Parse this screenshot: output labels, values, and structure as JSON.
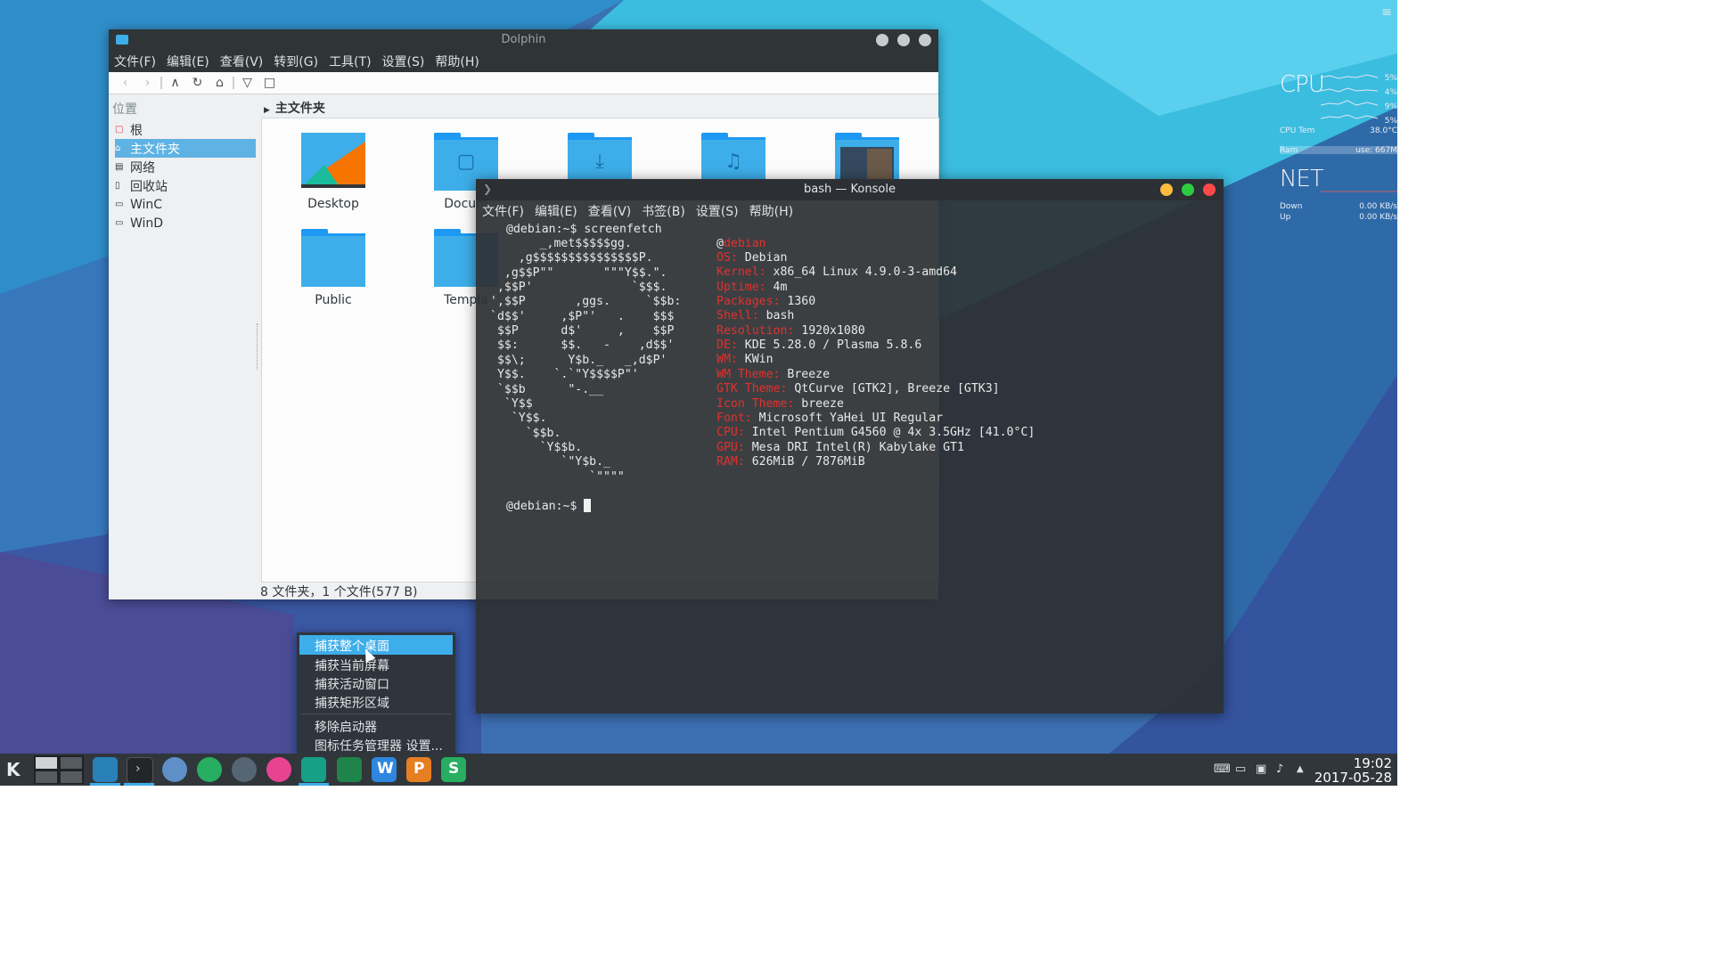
{
  "dolphin": {
    "title": "Dolphin",
    "menu": [
      "文件(F)",
      "编辑(E)",
      "查看(V)",
      "转到(G)",
      "工具(T)",
      "设置(S)",
      "帮助(H)"
    ],
    "places_header": "位置",
    "places": [
      {
        "label": "根",
        "icon": "root-folder-icon"
      },
      {
        "label": "主文件夹",
        "icon": "home-icon",
        "selected": true
      },
      {
        "label": "网络",
        "icon": "network-icon"
      },
      {
        "label": "回收站",
        "icon": "trash-icon"
      },
      {
        "label": "WinC",
        "icon": "drive-icon"
      },
      {
        "label": "WinD",
        "icon": "drive-icon"
      }
    ],
    "breadcrumb": "主文件夹",
    "files": [
      {
        "label": "Desktop"
      },
      {
        "label": "Docum"
      },
      {
        "label": "Public"
      },
      {
        "label": "Templa"
      }
    ],
    "status": "8 文件夹，1 个文件(577 B)"
  },
  "konsole": {
    "title": "bash — Konsole",
    "menu": [
      "文件(F)",
      "编辑(E)",
      "查看(V)",
      "书签(B)",
      "设置(S)",
      "帮助(H)"
    ],
    "command_line": "@debian:~$ screenfetch",
    "prompt": "@debian:~$ ",
    "logo": [
      "       _,met$$$$$gg.",
      "    ,g$$$$$$$$$$$$$$$P.",
      "  ,g$$P\"\"       \"\"\"Y$$.\".",
      " ,$$P'              `$$$.",
      "',$$P       ,ggs.     `$$b:",
      "`d$$'     ,$P\"'   .    $$$",
      " $$P      d$'     ,    $$P",
      " $$:      $$.   -    ,d$$'",
      " $$\\;      Y$b._   _,d$P'",
      " Y$$.    `.`\"Y$$$$P\"'",
      " `$$b      \"-.__",
      "  `Y$$",
      "   `Y$$.",
      "     `$$b.",
      "       `Y$$b.",
      "          `\"Y$b._",
      "              `\"\"\"\""
    ],
    "host_user": "@",
    "host_name": "debian",
    "info": [
      {
        "key": "OS:",
        "value": " Debian"
      },
      {
        "key": "Kernel:",
        "value": " x86_64 Linux 4.9.0-3-amd64"
      },
      {
        "key": "Uptime:",
        "value": " 4m"
      },
      {
        "key": "Packages:",
        "value": " 1360"
      },
      {
        "key": "Shell:",
        "value": " bash"
      },
      {
        "key": "Resolution:",
        "value": " 1920x1080"
      },
      {
        "key": "DE:",
        "value": " KDE 5.28.0 / Plasma 5.8.6"
      },
      {
        "key": "WM:",
        "value": " KWin"
      },
      {
        "key": "WM Theme:",
        "value": " Breeze"
      },
      {
        "key": "GTK Theme:",
        "value": " QtCurve [GTK2], Breeze [GTK3]"
      },
      {
        "key": "Icon Theme:",
        "value": " breeze"
      },
      {
        "key": "Font:",
        "value": " Microsoft YaHei UI Regular"
      },
      {
        "key": "CPU:",
        "value": " Intel Pentium G4560 @ 4x 3.5GHz [41.0°C]"
      },
      {
        "key": "GPU:",
        "value": " Mesa DRI Intel(R) Kabylake GT1"
      },
      {
        "key": "RAM:",
        "value": " 626MiB / 7876MiB"
      }
    ]
  },
  "context_menu": {
    "items": [
      "捕获整个桌面",
      "捕获当前屏幕",
      "捕获活动窗口",
      "捕获矩形区域"
    ],
    "items2": [
      "移除启动器",
      "图标任务管理器 设置..."
    ]
  },
  "conky": {
    "cpu_label": "CPU",
    "cpu_cores": [
      "5%",
      "4%",
      "9%",
      "5%"
    ],
    "cpu_temp_label": "CPU Tem",
    "cpu_temp_value": "38.0°C",
    "ram_label": "Ram",
    "ram_value": "use: 667M",
    "net_label": "NET",
    "down_label": "Down",
    "down_value": "0.00 KB/s",
    "up_label": "Up",
    "up_value": "0.00 KB/s"
  },
  "taskbar": {
    "clock_time": "19:02",
    "clock_date": "2017-05-28",
    "apps": [
      "dolphin-icon",
      "konsole-icon",
      "chromium-icon",
      "audio-player-icon",
      "network-tool-icon",
      "media-icon",
      "screenshot-icon",
      "system-monitor-icon",
      "wps-writer-icon",
      "wps-presentation-icon",
      "wps-spreadsheet-icon"
    ]
  },
  "colors": {
    "accent": "#3daee9",
    "terminal_red": "#e0312d"
  }
}
